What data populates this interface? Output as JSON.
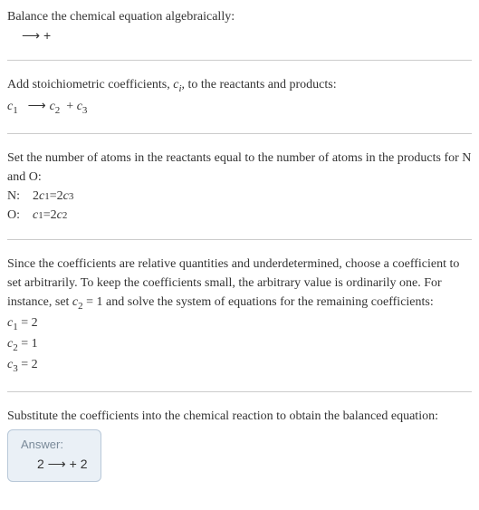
{
  "section1": {
    "title": "Balance the chemical equation algebraically:",
    "reaction": " ⟶  + "
  },
  "section2": {
    "intro_a": "Add stoichiometric coefficients, ",
    "intro_b": ", to the reactants and products:",
    "c_sym": "c",
    "i_sym": "i",
    "reaction_parts": {
      "c": "c",
      "one": "1",
      "arrow": " ⟶ ",
      "two": "2",
      "plus": " + ",
      "three": "3"
    }
  },
  "section3": {
    "intro": "Set the number of atoms in the reactants equal to the number of atoms in the products for N and O:",
    "rows": [
      {
        "label": "N: ",
        "lhs_coef": "2 ",
        "lhs_c": "c",
        "lhs_sub": "1",
        "eq": " = ",
        "rhs_coef": "2 ",
        "rhs_c": "c",
        "rhs_sub": "3"
      },
      {
        "label": "O: ",
        "lhs_coef": "",
        "lhs_c": "c",
        "lhs_sub": "1",
        "eq": " = ",
        "rhs_coef": "2 ",
        "rhs_c": "c",
        "rhs_sub": "2"
      }
    ]
  },
  "section4": {
    "intro_a": "Since the coefficients are relative quantities and underdetermined, choose a coefficient to set arbitrarily. To keep the coefficients small, the arbitrary value is ordinarily one. For instance, set ",
    "c_sym": "c",
    "c_sub": "2",
    "intro_b": " = 1 and solve the system of equations for the remaining coefficients:",
    "sols": [
      {
        "c": "c",
        "sub": "1",
        "val": " = 2"
      },
      {
        "c": "c",
        "sub": "2",
        "val": " = 1"
      },
      {
        "c": "c",
        "sub": "3",
        "val": " = 2"
      }
    ]
  },
  "section5": {
    "intro": "Substitute the coefficients into the chemical reaction to obtain the balanced equation:",
    "answer_label": "Answer:",
    "answer": "2  ⟶  + 2 "
  }
}
